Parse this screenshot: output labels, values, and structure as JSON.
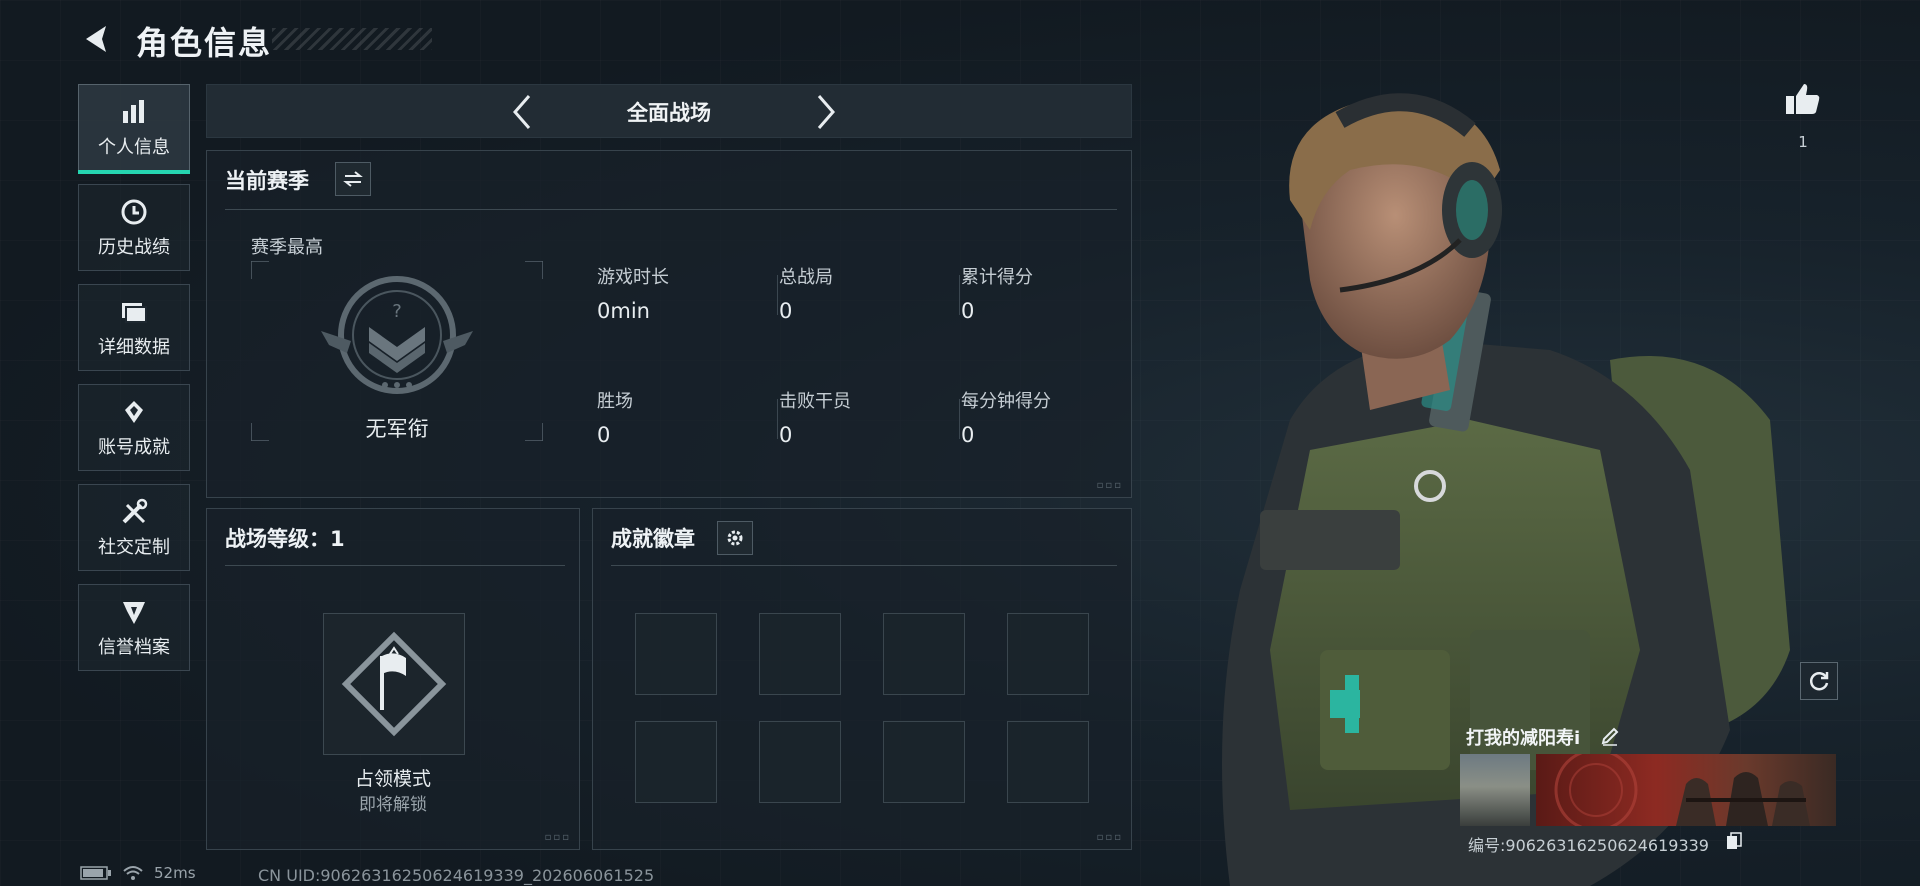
{
  "header": {
    "title": "角色信息"
  },
  "sidebar": {
    "items": [
      {
        "label": "个人信息",
        "icon": "bar-chart-icon",
        "active": true
      },
      {
        "label": "历史战绩",
        "icon": "history-clock-icon"
      },
      {
        "label": "详细数据",
        "icon": "folder-data-icon"
      },
      {
        "label": "账号成就",
        "icon": "medal-icon"
      },
      {
        "label": "社交定制",
        "icon": "wrench-screwdriver-icon"
      },
      {
        "label": "信誉档案",
        "icon": "credit-shield-icon"
      }
    ]
  },
  "mode_selector": {
    "label": "全面战场"
  },
  "season": {
    "title": "当前赛季",
    "season_high_label": "赛季最高",
    "rank_name": "无军衔",
    "stats": [
      {
        "key": "游戏时长",
        "value": "0min"
      },
      {
        "key": "总战局",
        "value": "0"
      },
      {
        "key": "累计得分",
        "value": "0"
      },
      {
        "key": "胜场",
        "value": "0"
      },
      {
        "key": "击败干员",
        "value": "0"
      },
      {
        "key": "每分钟得分",
        "value": "0"
      }
    ]
  },
  "battlefield_level": {
    "title": "战场等级：1",
    "mode_name": "占领模式",
    "mode_status": "即将解锁"
  },
  "badges": {
    "title": "成就徽章",
    "slots": 8
  },
  "profile": {
    "likes": "1",
    "player_name": "打我的减阳寿i",
    "id_line": "编号:9062631625062461933​9"
  },
  "footer": {
    "ping": "52ms",
    "uid": "CN UID:9062631625062461933​9_202606061525"
  },
  "colors": {
    "accent": "#25d4b0",
    "background": "#141d25"
  }
}
